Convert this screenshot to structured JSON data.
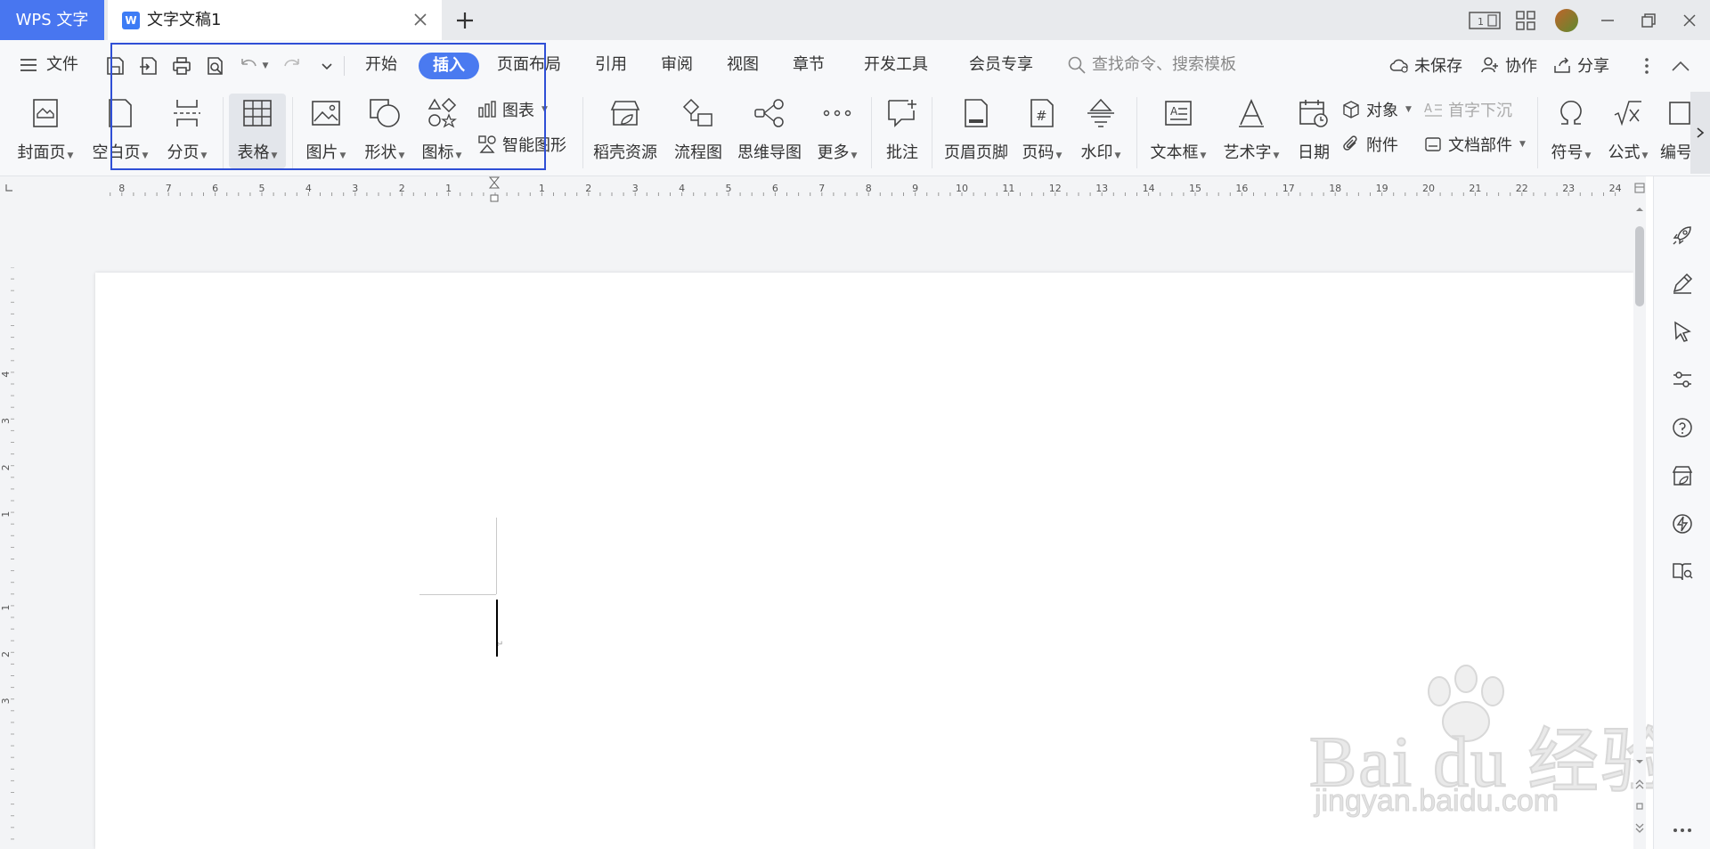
{
  "titlebar": {
    "app_tab": "WPS 文字",
    "doc_tab_title": "文字文稿1"
  },
  "menubar": {
    "file_label": "文件",
    "tabs": [
      "开始",
      "插入",
      "页面布局",
      "引用",
      "审阅",
      "视图",
      "章节",
      "开发工具",
      "会员专享"
    ],
    "active_tab": "插入",
    "search_placeholder": "查找命令、搜索模板",
    "unsaved_label": "未保存",
    "collab_label": "协作",
    "share_label": "分享"
  },
  "ribbon": {
    "cover_page": "封面页",
    "blank_page": "空白页",
    "page_break": "分页",
    "table": "表格",
    "picture": "图片",
    "shape": "形状",
    "icon": "图标",
    "chart": "图表",
    "smart_art": "智能图形",
    "docer_resources": "稻壳资源",
    "flowchart": "流程图",
    "mind_map": "思维导图",
    "more": "更多",
    "comment": "批注",
    "header_footer": "页眉页脚",
    "page_number": "页码",
    "watermark": "水印",
    "text_box": "文本框",
    "word_art": "艺术字",
    "date": "日期",
    "object": "对象",
    "attachment": "附件",
    "drop_cap": "首字下沉",
    "doc_parts": "文档部件",
    "symbol": "符号",
    "formula": "公式",
    "edit_partial": "编号"
  },
  "ruler": {
    "h_left_labels": [
      "8",
      "7",
      "6",
      "5",
      "4",
      "3",
      "2",
      "1"
    ],
    "h_right_labels": [
      "1",
      "2",
      "3",
      "4",
      "5",
      "6",
      "7",
      "8",
      "9",
      "10",
      "11",
      "12",
      "13",
      "14",
      "15",
      "16",
      "17",
      "18",
      "19",
      "20",
      "21",
      "22",
      "23",
      "24"
    ],
    "v_labels": [
      "4",
      "3",
      "2",
      "1",
      "1",
      "2",
      "3"
    ]
  },
  "watermark": {
    "brand": "Bai du 经验",
    "url": "jingyan.baidu.com"
  },
  "colors": {
    "accent": "#4a7af0",
    "app_tab": "#4876f0",
    "highlight_box": "#2f4fd6"
  }
}
